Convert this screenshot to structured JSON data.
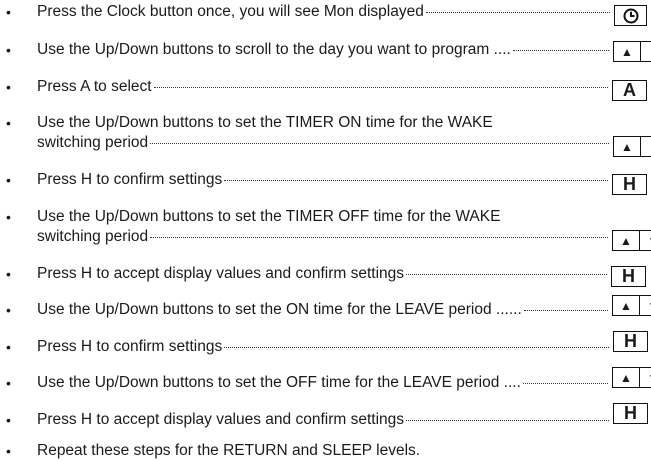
{
  "steps": [
    {
      "lines": [
        "Press the Clock button once, you will see Mon displayed"
      ],
      "buttons": [
        "clock"
      ]
    },
    {
      "lines": [
        "Use the Up/Down buttons to scroll to the day you want to program ...."
      ],
      "buttons": [
        "up",
        "down"
      ]
    },
    {
      "lines": [
        "Press A to select"
      ],
      "buttons": [
        "A"
      ]
    },
    {
      "lines": [
        "Use the Up/Down buttons to set the TIMER ON time for the WAKE",
        "switching period"
      ],
      "buttons": [
        "up",
        "down"
      ]
    },
    {
      "lines": [
        "Press H to confirm settings"
      ],
      "buttons": [
        "H"
      ]
    },
    {
      "lines": [
        "Use the Up/Down buttons to set the TIMER OFF time for the WAKE",
        "switching period"
      ],
      "buttons": [
        "up",
        "down"
      ]
    },
    {
      "lines": [
        "Press H to accept display values and confirm settings"
      ],
      "buttons": [
        "H"
      ]
    },
    {
      "lines": [
        "Use the Up/Down buttons to set the ON time for the LEAVE period ......"
      ],
      "buttons": [
        "up",
        "down"
      ]
    },
    {
      "lines": [
        "Press H to confirm settings"
      ],
      "buttons": [
        "H"
      ]
    },
    {
      "lines": [
        "Use the Up/Down buttons to set the OFF time for the LEAVE period ...."
      ],
      "buttons": [
        "up",
        "down"
      ]
    },
    {
      "lines": [
        "Press H to accept display values and confirm settings"
      ],
      "buttons": [
        "H"
      ]
    },
    {
      "lines": [
        "Repeat these steps for the RETURN and SLEEP levels."
      ],
      "buttons": []
    }
  ],
  "bullet": "•",
  "icons": {
    "clock": "clock-icon",
    "up": "up-arrow-icon",
    "down": "down-arrow-icon"
  },
  "glyphs": {
    "up": "▲",
    "down": "▼"
  }
}
